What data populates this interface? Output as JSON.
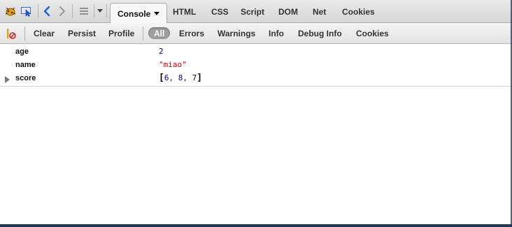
{
  "toolbar": {
    "tabs": [
      {
        "label": "Console",
        "active": true
      },
      {
        "label": "HTML"
      },
      {
        "label": "CSS"
      },
      {
        "label": "Script"
      },
      {
        "label": "DOM"
      },
      {
        "label": "Net"
      },
      {
        "label": "Cookies"
      }
    ]
  },
  "filters": [
    {
      "label": "Clear"
    },
    {
      "label": "Persist"
    },
    {
      "label": "Profile"
    },
    {
      "label": "All",
      "selected": true
    },
    {
      "label": "Errors"
    },
    {
      "label": "Warnings"
    },
    {
      "label": "Info"
    },
    {
      "label": "Debug Info"
    },
    {
      "label": "Cookies"
    }
  ],
  "console": {
    "rows": [
      {
        "key": "age",
        "value": "2"
      },
      {
        "key": "name",
        "value": "\"miao\""
      },
      {
        "key": "score",
        "open": "[",
        "items": [
          "6",
          "8",
          "7"
        ],
        "close": "]"
      }
    ]
  },
  "colors": {
    "number": "#000088",
    "string": "#cc0000",
    "accent_blue": "#1c5fd8"
  },
  "icons": [
    "firebug-icon",
    "inspect-icon",
    "back-arrow-icon",
    "forward-arrow-icon",
    "menu-lines-icon",
    "dropdown-caret-icon",
    "clear-console-icon",
    "expand-twisty-icon"
  ]
}
